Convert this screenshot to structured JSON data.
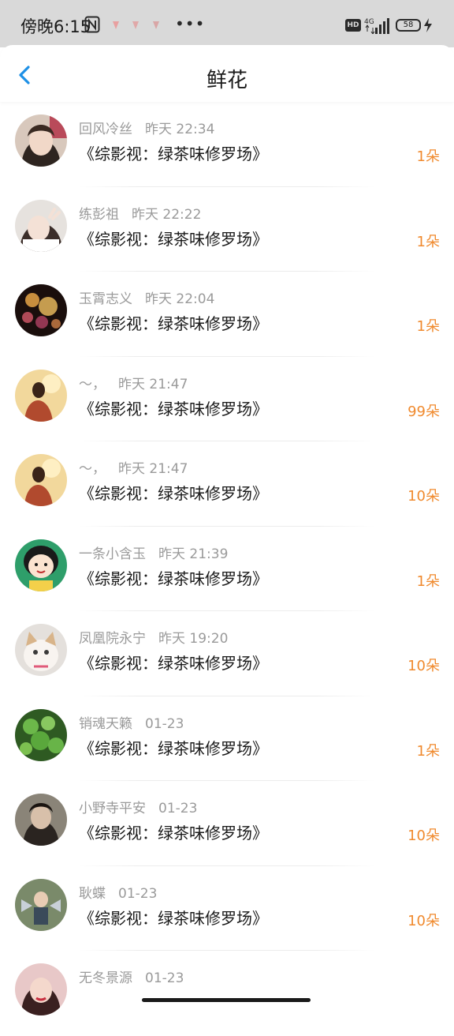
{
  "status_bar": {
    "time": "傍晚6:15",
    "network": "4G",
    "hd": "HD",
    "battery": "58"
  },
  "header": {
    "title": "鲜花",
    "back_icon": "chevron-left-icon"
  },
  "colors": {
    "accent": "#1e90e6",
    "count": "#f08a2e",
    "meta": "#9a9a9a"
  },
  "items": [
    {
      "name": "回风冷丝",
      "time": "昨天 22:34",
      "title": "《综影视：绿茶味修罗场》",
      "count": "1朵"
    },
    {
      "name": "练彭祖",
      "time": "昨天 22:22",
      "title": "《综影视：绿茶味修罗场》",
      "count": "1朵"
    },
    {
      "name": "玉霄志义",
      "time": "昨天 22:04",
      "title": "《综影视：绿茶味修罗场》",
      "count": "1朵"
    },
    {
      "name": "～，",
      "time": "昨天 21:47",
      "title": "《综影视：绿茶味修罗场》",
      "count": "99朵"
    },
    {
      "name": "～，",
      "time": "昨天 21:47",
      "title": "《综影视：绿茶味修罗场》",
      "count": "10朵"
    },
    {
      "name": "一条小含玉",
      "time": "昨天 21:39",
      "title": "《综影视：绿茶味修罗场》",
      "count": "1朵"
    },
    {
      "name": "凤凰院永宁",
      "time": "昨天 19:20",
      "title": "《综影视：绿茶味修罗场》",
      "count": "10朵"
    },
    {
      "name": "销魂天籁",
      "time": "01-23",
      "title": "《综影视：绿茶味修罗场》",
      "count": "1朵"
    },
    {
      "name": "小野寺平安",
      "time": "01-23",
      "title": "《综影视：绿茶味修罗场》",
      "count": "10朵"
    },
    {
      "name": "耿蝶",
      "time": "01-23",
      "title": "《综影视：绿茶味修罗场》",
      "count": "10朵"
    },
    {
      "name": "无冬景源",
      "time": "01-23",
      "title": "",
      "count": ""
    }
  ]
}
